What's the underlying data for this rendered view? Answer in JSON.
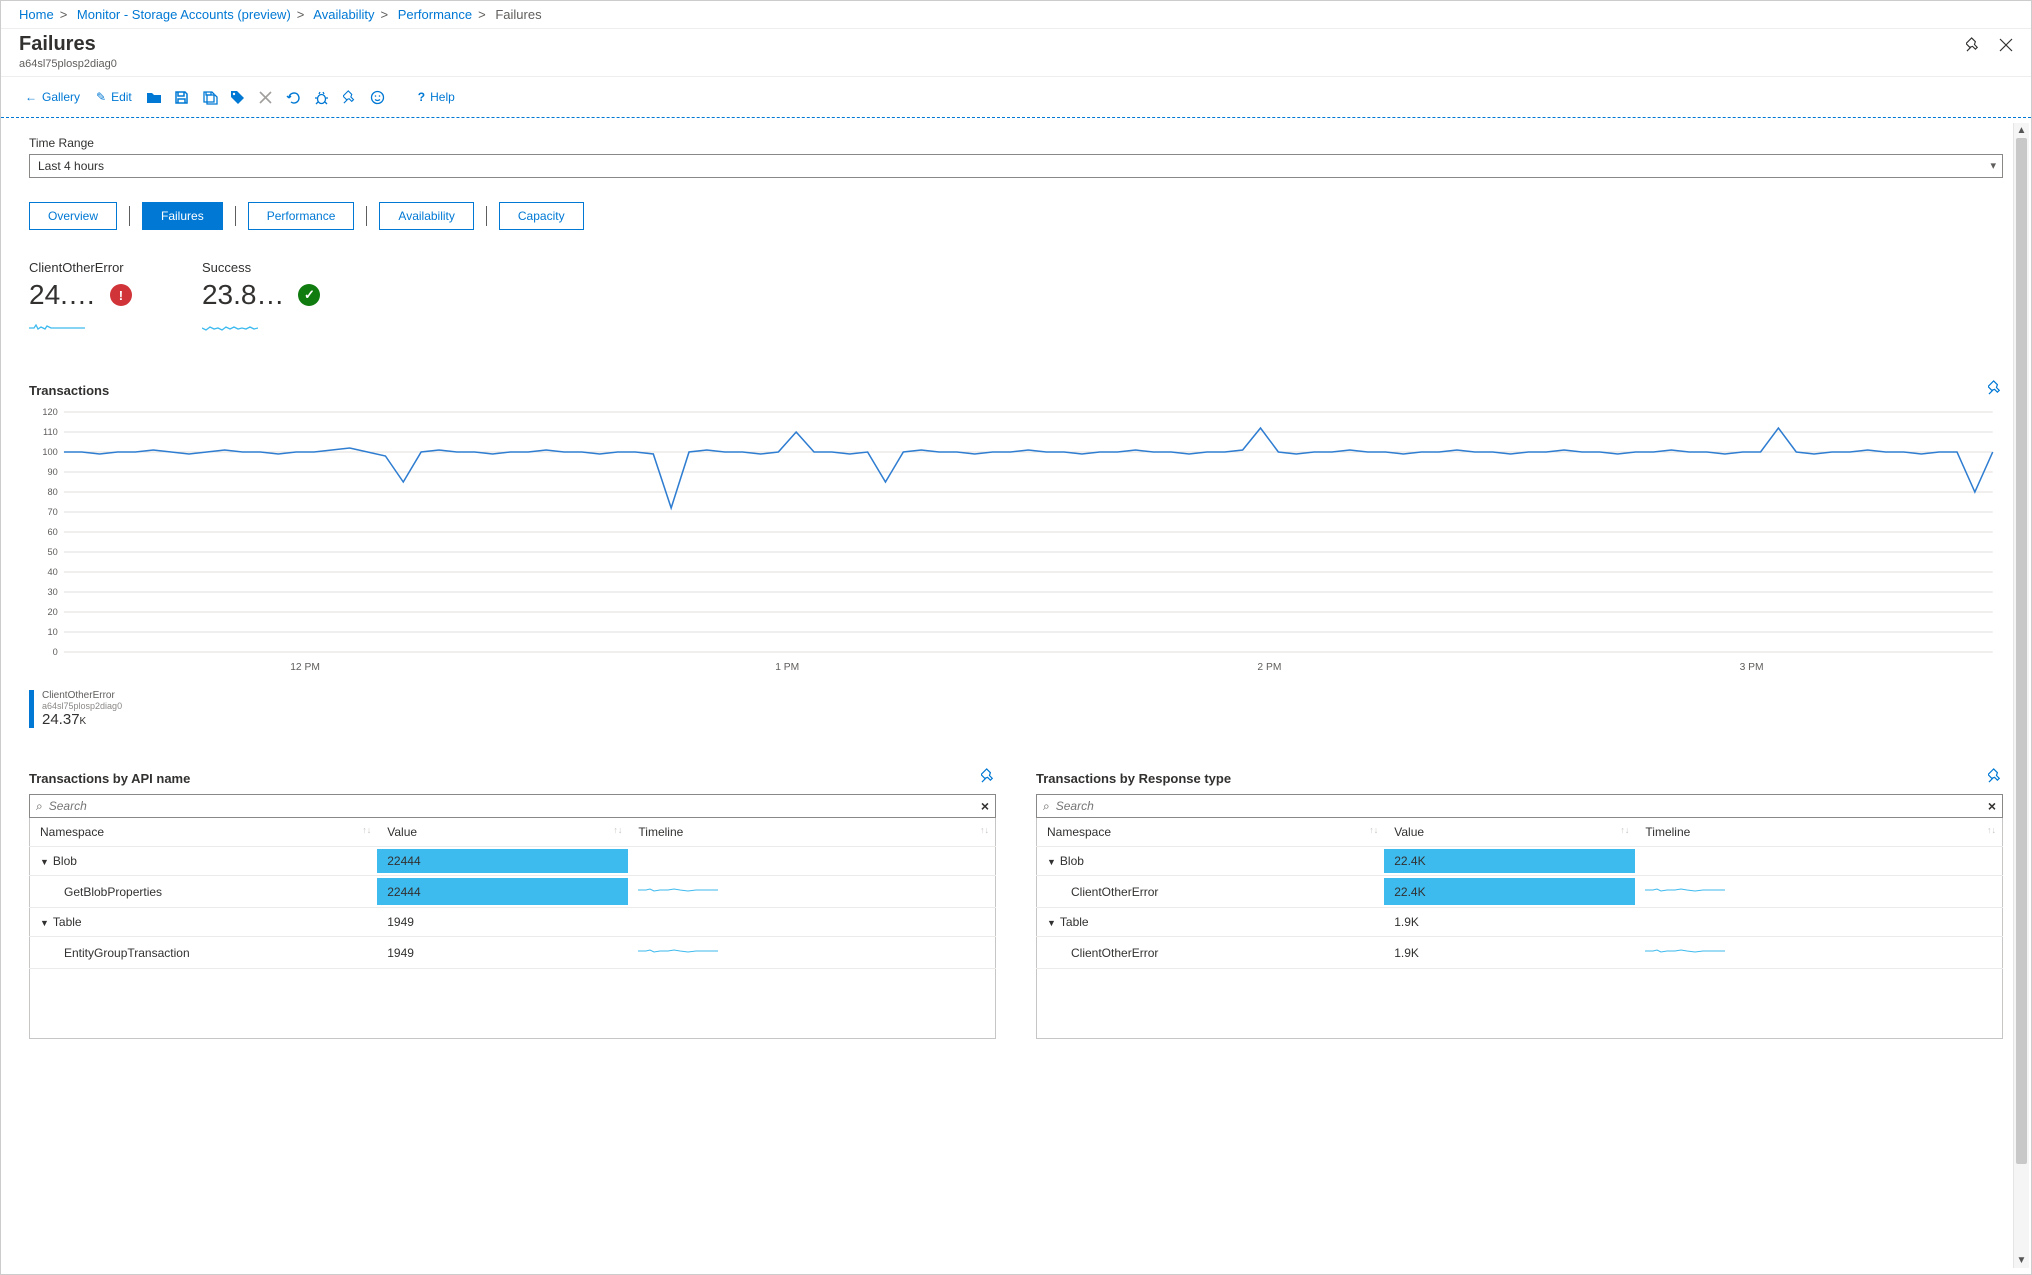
{
  "breadcrumb": {
    "items": [
      {
        "label": "Home"
      },
      {
        "label": "Monitor - Storage Accounts (preview)"
      },
      {
        "label": "Availability"
      },
      {
        "label": "Performance"
      }
    ],
    "current": "Failures"
  },
  "page": {
    "title": "Failures",
    "subtitle": "a64sl75plosp2diag0"
  },
  "toolbar": {
    "back_gallery": "Gallery",
    "edit": "Edit",
    "help": "Help"
  },
  "filter": {
    "label": "Time Range",
    "value": "Last 4 hours"
  },
  "tabs": [
    {
      "label": "Overview",
      "active": false
    },
    {
      "label": "Failures",
      "active": true
    },
    {
      "label": "Performance",
      "active": false
    },
    {
      "label": "Availability",
      "active": false
    },
    {
      "label": "Capacity",
      "active": false
    }
  ],
  "metrics": [
    {
      "label": "ClientOtherError",
      "value": "24.…",
      "status": "red",
      "status_glyph": "!",
      "spark_color": "#3dbaee"
    },
    {
      "label": "Success",
      "value": "23.8…",
      "status": "green",
      "status_glyph": "✓",
      "spark_color": "#3dbaee"
    }
  ],
  "transactions": {
    "title": "Transactions",
    "legend": {
      "line1": "ClientOtherError",
      "line2": "a64sl75plosp2diag0",
      "value": "24.37",
      "unit": "K"
    }
  },
  "chart_data": {
    "type": "line",
    "title": "Transactions",
    "xlabel": "",
    "ylabel": "",
    "ylim": [
      0,
      120
    ],
    "y_ticks": [
      0,
      10,
      20,
      30,
      40,
      50,
      60,
      70,
      80,
      90,
      100,
      110,
      120
    ],
    "x_ticks": [
      "12 PM",
      "1 PM",
      "2 PM",
      "3 PM"
    ],
    "series": [
      {
        "name": "ClientOtherError",
        "color": "#2f7dd1",
        "values": [
          100,
          100,
          99,
          100,
          100,
          101,
          100,
          99,
          100,
          101,
          100,
          100,
          99,
          100,
          100,
          101,
          102,
          100,
          98,
          85,
          100,
          101,
          100,
          100,
          99,
          100,
          100,
          101,
          100,
          100,
          99,
          100,
          100,
          99,
          72,
          100,
          101,
          100,
          100,
          99,
          100,
          110,
          100,
          100,
          99,
          100,
          85,
          100,
          101,
          100,
          100,
          99,
          100,
          100,
          101,
          100,
          100,
          99,
          100,
          100,
          101,
          100,
          100,
          99,
          100,
          100,
          101,
          112,
          100,
          99,
          100,
          100,
          101,
          100,
          100,
          99,
          100,
          100,
          101,
          100,
          100,
          99,
          100,
          100,
          101,
          100,
          100,
          99,
          100,
          100,
          101,
          100,
          100,
          99,
          100,
          100,
          112,
          100,
          99,
          100,
          100,
          101,
          100,
          100,
          99,
          100,
          100,
          80,
          100
        ]
      }
    ]
  },
  "tables": {
    "api": {
      "title": "Transactions by API name",
      "search_placeholder": "Search",
      "columns": [
        "Namespace",
        "Value",
        "Timeline"
      ],
      "rows": [
        {
          "label": "Blob",
          "level": 0,
          "expandable": true,
          "value": "22444",
          "bar_pct": 100,
          "spark": false
        },
        {
          "label": "GetBlobProperties",
          "level": 1,
          "expandable": false,
          "value": "22444",
          "bar_pct": 100,
          "spark": true
        },
        {
          "label": "Table",
          "level": 0,
          "expandable": true,
          "value": "1949",
          "bar_pct": 0,
          "spark": false
        },
        {
          "label": "EntityGroupTransaction",
          "level": 1,
          "expandable": false,
          "value": "1949",
          "bar_pct": 0,
          "spark": true
        }
      ]
    },
    "response": {
      "title": "Transactions by Response type",
      "search_placeholder": "Search",
      "columns": [
        "Namespace",
        "Value",
        "Timeline"
      ],
      "rows": [
        {
          "label": "Blob",
          "level": 0,
          "expandable": true,
          "value": "22.4K",
          "bar_pct": 100,
          "spark": false
        },
        {
          "label": "ClientOtherError",
          "level": 1,
          "expandable": false,
          "value": "22.4K",
          "bar_pct": 100,
          "spark": true
        },
        {
          "label": "Table",
          "level": 0,
          "expandable": true,
          "value": "1.9K",
          "bar_pct": 0,
          "spark": false
        },
        {
          "label": "ClientOtherError",
          "level": 1,
          "expandable": false,
          "value": "1.9K",
          "bar_pct": 0,
          "spark": true
        }
      ]
    }
  }
}
